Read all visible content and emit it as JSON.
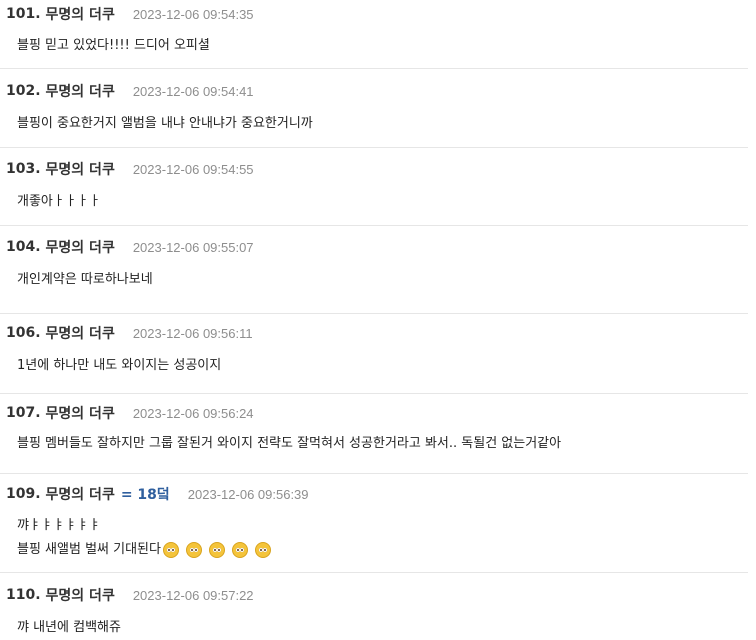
{
  "comments": [
    {
      "num": "101.",
      "author": "무명의 더쿠",
      "time": "2023-12-06 09:54:35",
      "lines": [
        "블핑 믿고 있었다!!!! 드디어 오피셜"
      ]
    },
    {
      "num": "102.",
      "author": "무명의 더쿠",
      "time": "2023-12-06 09:54:41",
      "lines": [
        "블핑이 중요한거지 앨범을 내냐 안내냐가 중요한거니까"
      ]
    },
    {
      "num": "103.",
      "author": "무명의 더쿠",
      "time": "2023-12-06 09:54:55",
      "lines": [
        "개좋아ㅏㅏㅏㅏ"
      ]
    },
    {
      "num": "104.",
      "author": "무명의 더쿠",
      "time": "2023-12-06 09:55:07",
      "lines": [
        "개인계약은 따로하나보네"
      ]
    },
    {
      "num": "106.",
      "author": "무명의 더쿠",
      "time": "2023-12-06 09:56:11",
      "lines": [
        "1년에 하나만 내도 와이지는 성공이지"
      ]
    },
    {
      "num": "107.",
      "author": "무명의 더쿠",
      "time": "2023-12-06 09:56:24",
      "lines": [
        "블핑 멤버들도 잘하지만 그룹 잘된거 와이지 전략도 잘먹혀서 성공한거라고 봐서.. 독될건 없는거같아"
      ]
    },
    {
      "num": "109.",
      "author": "무명의 더쿠",
      "extra": "= 18덬",
      "time": "2023-12-06 09:56:39",
      "lines": [
        "꺄ㅑㅑㅑㅑㅑㅑ",
        "블핑 새앨범 벌써 기대된다"
      ],
      "emoji": "pleading-face-icon"
    },
    {
      "num": "110.",
      "author": "무명의 더쿠",
      "time": "2023-12-06 09:57:22",
      "lines": [
        "꺄 내년에 컴백해쥬"
      ]
    }
  ]
}
